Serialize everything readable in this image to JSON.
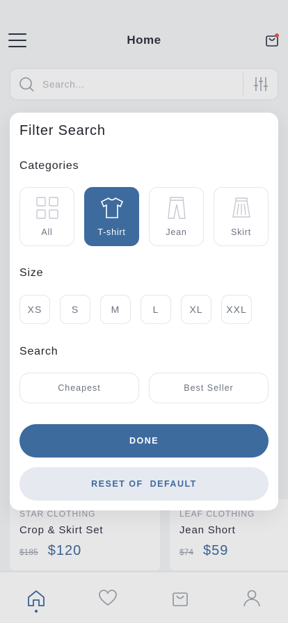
{
  "header": {
    "title": "Home"
  },
  "search": {
    "placeholder": "Search..."
  },
  "products": [
    {
      "brand": "STAR CLOTHING",
      "name": "Crop & Skirt Set",
      "old_price": "$185",
      "price": "$120"
    },
    {
      "brand": "LEAF CLOTHING",
      "name": "Jean Short",
      "old_price": "$74",
      "price": "$59"
    }
  ],
  "modal": {
    "title": "Filter Search",
    "categories_title": "Categories",
    "categories": [
      {
        "label": "All",
        "icon": "grid-icon"
      },
      {
        "label": "T-shirt",
        "icon": "tshirt-icon",
        "selected": true
      },
      {
        "label": "Jean",
        "icon": "jeans-icon"
      },
      {
        "label": "Skirt",
        "icon": "skirt-icon"
      }
    ],
    "size_title": "Size",
    "sizes": [
      "XS",
      "S",
      "M",
      "L",
      "XL",
      "XXL"
    ],
    "search_title": "Search",
    "search_options": [
      "Cheapest",
      "Best Seller"
    ],
    "done_label": "DONE",
    "reset_label": "RESET OF  DEFAULT"
  },
  "tabs": [
    {
      "name": "home",
      "icon": "home-icon",
      "active": true
    },
    {
      "name": "favorites",
      "icon": "heart-icon"
    },
    {
      "name": "cart",
      "icon": "bag-icon"
    },
    {
      "name": "profile",
      "icon": "user-icon"
    }
  ],
  "colors": {
    "accent": "#3E6B9E",
    "reset_bg": "#E6E9F0",
    "notification": "#E05A5A"
  }
}
